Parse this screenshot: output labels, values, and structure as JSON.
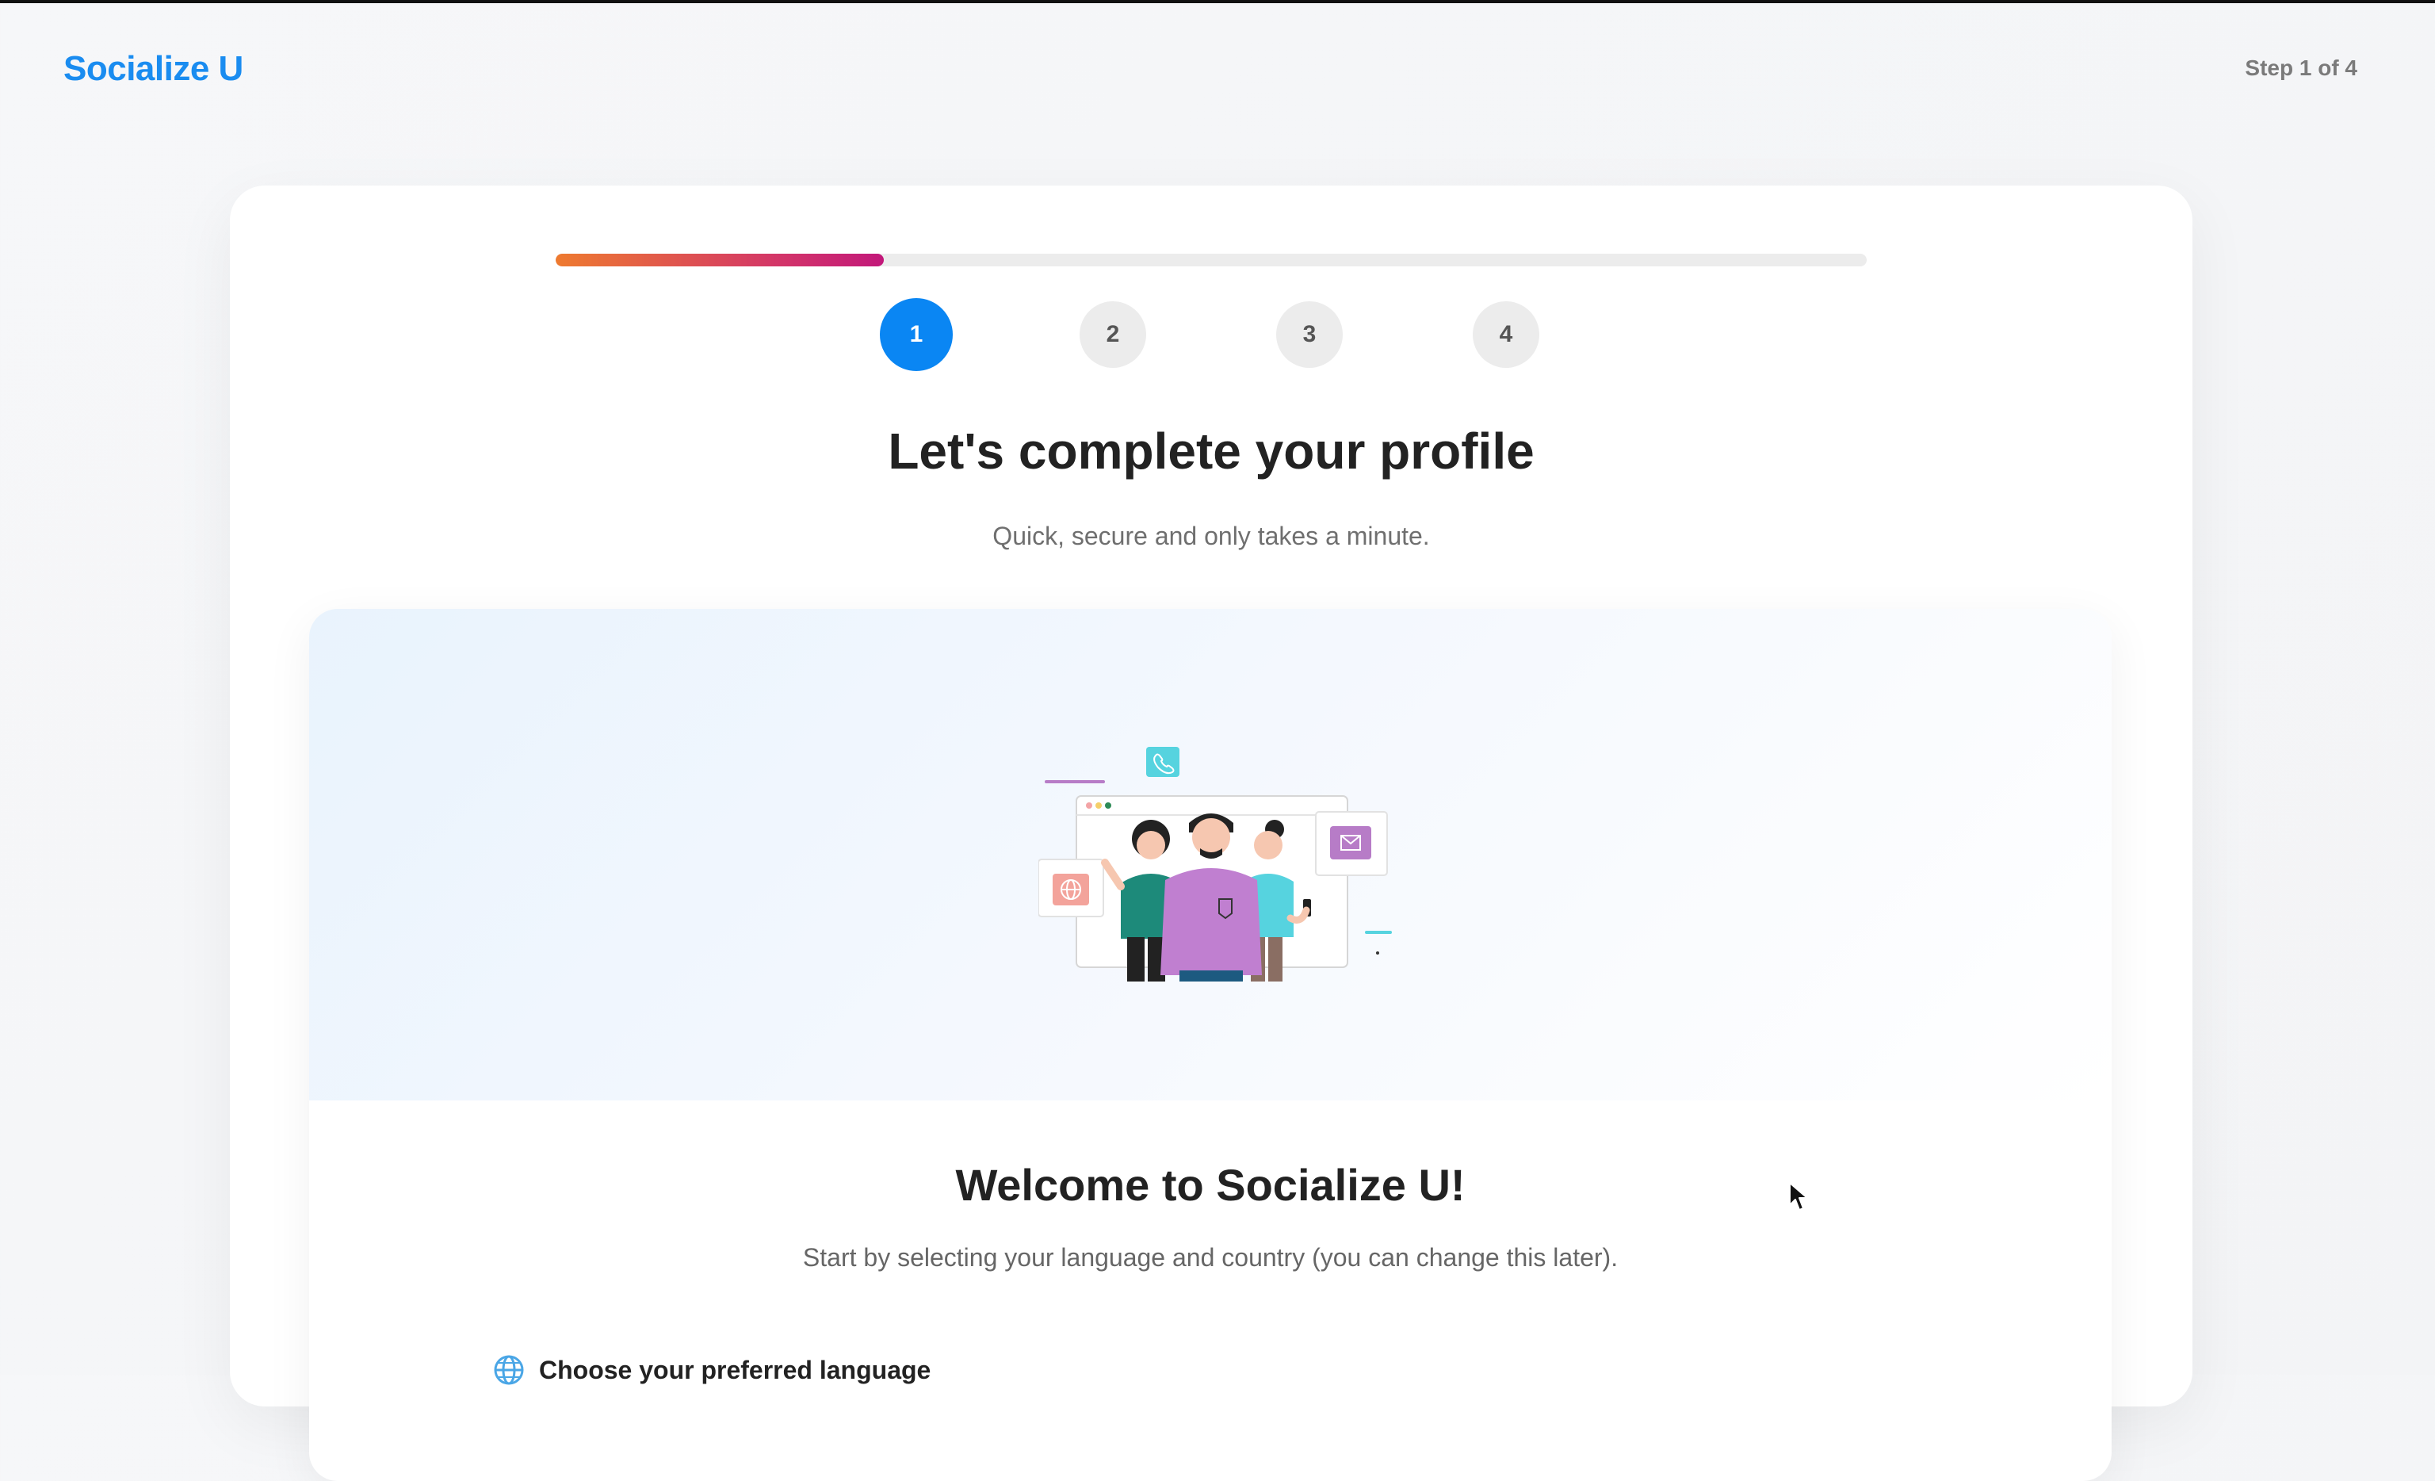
{
  "header": {
    "brand": "Socialize U",
    "step_counter": "Step 1 of 4"
  },
  "progress": {
    "value": 0.25
  },
  "steps": [
    {
      "label": "1",
      "state": "active"
    },
    {
      "label": "2",
      "state": "inactive"
    },
    {
      "label": "3",
      "state": "inactive"
    },
    {
      "label": "4",
      "state": "inactive"
    }
  ],
  "intro": {
    "title": "Let's complete your profile",
    "subtitle": "Quick, secure and only takes a minute."
  },
  "welcome": {
    "title": "Welcome to Socialize U!",
    "subtitle": "Start by selecting your language and country (you can change this later).",
    "language_label": "Choose your preferred language",
    "language_icon": "globe-icon"
  },
  "colors": {
    "brand": "#1a8cf0",
    "active_step": "#0a86f3",
    "progress_start": "#ee7a2f",
    "progress_end": "#c2187a"
  }
}
